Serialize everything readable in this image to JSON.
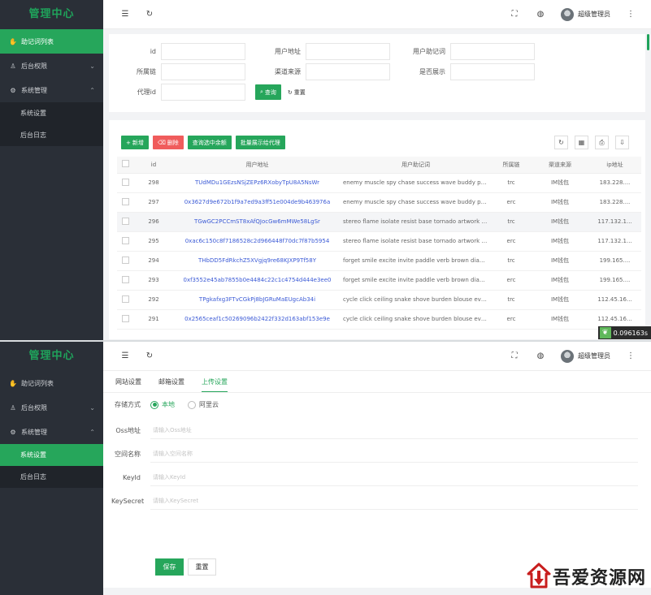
{
  "brand": "管理中心",
  "colors": {
    "accent": "#26a65b",
    "sidebar": "#2a2f37",
    "danger": "#f05c5c",
    "link": "#3c5bd6"
  },
  "sidebar": {
    "items": [
      {
        "label": "助记词列表",
        "icon": "hand-icon"
      },
      {
        "label": "后台权限",
        "icon": "user-icon"
      },
      {
        "label": "系统管理",
        "icon": "gear-icon"
      }
    ],
    "sub_items": [
      "系统设置",
      "后台日志"
    ]
  },
  "header": {
    "user": "超级管理员"
  },
  "filter": {
    "labels": [
      "id",
      "用户地址",
      "用户助记词",
      "所属链",
      "渠道来源",
      "是否展示",
      "代理id"
    ],
    "search_button": "查询",
    "reset_button": "重置"
  },
  "table": {
    "buttons": {
      "add": "新增",
      "delete": "删除",
      "query_balance": "查询选中余额",
      "batch": "批量展示给代理"
    },
    "columns": [
      "id",
      "用户地址",
      "用户助记词",
      "所属链",
      "渠道来源",
      "ip地址"
    ],
    "rows": [
      {
        "id": "298",
        "addr": "TUdMDu1GEzsNSjZEPz6RXobyTpU8A5NsWr",
        "mnemonic": "enemy muscle spy chase success wave buddy pover...",
        "chain": "trc",
        "source": "IM钱包",
        "ip": "183.228...."
      },
      {
        "id": "297",
        "addr": "0x3627d9e672b1f9a7ed9a3ff51e004de9b463976a",
        "mnemonic": "enemy muscle spy chase success wave buddy pover...",
        "chain": "erc",
        "source": "IM钱包",
        "ip": "183.228...."
      },
      {
        "id": "296",
        "addr": "TGwGC2PCCmST8xAfQJocGw6mMWe58LgSr",
        "mnemonic": "stereo flame isolate resist base tornado artwork kiss ...",
        "chain": "trc",
        "source": "IM钱包",
        "ip": "117.132.1..."
      },
      {
        "id": "295",
        "addr": "0xac6c150c8f7186528c2d966448f70dc7f87b5954",
        "mnemonic": "stereo flame isolate resist base tornado artwork kiss ...",
        "chain": "erc",
        "source": "IM钱包",
        "ip": "117.132.1..."
      },
      {
        "id": "294",
        "addr": "THbDD5FdRkchZ5XVgjq9re68KJXP9Tf58Y",
        "mnemonic": "forget smile excite invite paddle verb brown diagram ...",
        "chain": "trc",
        "source": "IM钱包",
        "ip": "199.165...."
      },
      {
        "id": "293",
        "addr": "0xf3552e45ab7855b0e4484c22c1c4754d444e3ee0",
        "mnemonic": "forget smile excite invite paddle verb brown diagram ...",
        "chain": "erc",
        "source": "IM钱包",
        "ip": "199.165...."
      },
      {
        "id": "292",
        "addr": "TPgkafxg3FTvCGkPj8bJGRuMaEUgcAb34i",
        "mnemonic": "cycle click ceiling snake shove burden blouse evolve ...",
        "chain": "trc",
        "source": "IM钱包",
        "ip": "112.45.16..."
      },
      {
        "id": "291",
        "addr": "0x2565ceaf1c50269096b2422f332d163abf153e9e",
        "mnemonic": "cycle click ceiling snake shove burden blouse evolve ...",
        "chain": "erc",
        "source": "IM钱包",
        "ip": "112.45.16..."
      }
    ]
  },
  "timer": "0.096163s",
  "settings": {
    "tabs": [
      "网站设置",
      "邮箱设置",
      "上传设置"
    ],
    "storage_label": "存储方式",
    "storage_options": [
      "本地",
      "阿里云"
    ],
    "fields": [
      {
        "label": "Oss地址",
        "placeholder": "请输入Oss地址"
      },
      {
        "label": "空间名称",
        "placeholder": "请输入空间名称"
      },
      {
        "label": "KeyId",
        "placeholder": "请输入KeyId"
      },
      {
        "label": "KeySecret",
        "placeholder": "请输入KeySecret"
      }
    ],
    "save": "保存",
    "reset": "重置"
  },
  "watermark": "吾爱资源网"
}
